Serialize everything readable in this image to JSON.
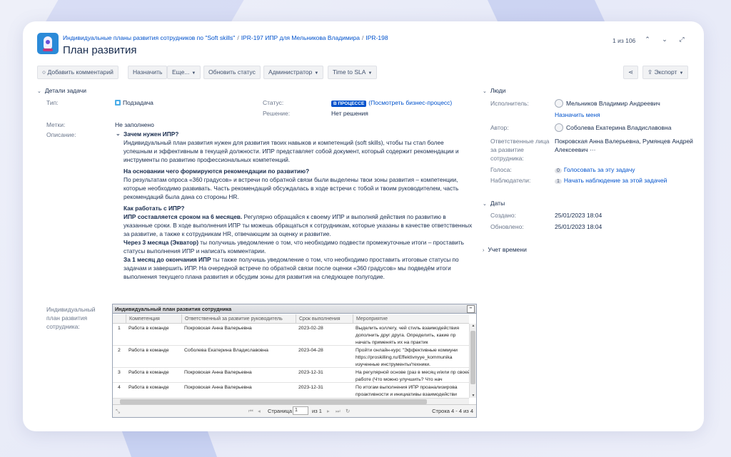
{
  "header": {
    "breadcrumb": [
      "Индивидуальные планы развития сотрудников по \"Soft skills\"",
      "IPR-197 ИПР для Мельникова Владимира",
      "IPR-198"
    ],
    "title": "План развития",
    "pager": "1 из 106"
  },
  "toolbar": {
    "add_comment": "Добавить комментарий",
    "assign": "Назначить",
    "more": "Еще...",
    "update_status": "Обновить статус",
    "admin": "Администратор",
    "time_to_sla": "Time to SLA",
    "export": "Экспорт"
  },
  "details": {
    "title": "Детали задачи",
    "type_label": "Тип:",
    "type_value": "Подзадача",
    "status_label": "Статус:",
    "status_lozenge": "В ПРОЦЕССЕ",
    "status_link": "(Посмотреть бизнес-процесс)",
    "resolution_label": "Решение:",
    "resolution_value": "Нет решения",
    "labels_label": "Метки:",
    "labels_value": "Не заполнено",
    "description_label": "Описание:",
    "ipr_label": [
      "Индивидуальный",
      "план развития",
      "сотрудника:"
    ]
  },
  "description": {
    "h1": "Зачем нужен ИПР?",
    "p1": "Индивидуальный план развития нужен для развития твоих навыков и компетенций (soft skills), чтобы ты стал более успешным и эффективным в текущей должности. ИПР представляет собой документ, который содержит рекомендации и инструменты по развитию профессиональных компетенций.",
    "h2": "На основании чего формируются рекомендации по развитию?",
    "p2": "По результатам опроса «360 градусов» и встречи по обратной связи были выделены твои зоны развития – компетенции, которые необходимо развивать. Часть рекомендаций обсуждалась в ходе встречи с тобой и твоим руководителем, часть рекомендаций была дана со стороны HR.",
    "h3": "Как работать с ИПР?",
    "p3_bold": "ИПР составляется сроком на 6 месяцев.",
    "p3": " Регулярно обращайся к своему ИПР и выполняй действия по развитию в указанные сроки. В ходе выполнения ИПР ты можешь обращаться к сотрудникам, которые указаны в качестве ответственных за развитие, а также к сотрудникам HR, отвечающим за оценку и развитие.",
    "p4_bold": "Через 3 месяца (Экватор)",
    "p4": " ты получишь уведомление о том, что необходимо подвести промежуточные итоги – проставить статусы выполнения ИПР и написать комментарии.",
    "p5_bold": "За 1 месяц до окончания ИПР",
    "p5": " ты также получишь уведомление о том, что необходимо проставить итоговые статусы по задачам и завершить ИПР. На очередной встрече по обратной связи после оценки «360 градусов» мы подведём итоги выполнения текущего плана развития и обсудим зоны для развития на следующее полугодие."
  },
  "grid": {
    "title": "Индивидуальный план развития сотрудника",
    "columns": [
      "Компетенция",
      "Ответственный за развитие руководитель",
      "Срок выполнения",
      "Мероприятие"
    ],
    "rows": [
      {
        "n": "1",
        "comp": "Работа в команде",
        "resp": "Покровская Анна Валерьевна",
        "date": "2023-02-28",
        "act": "Выделить коллегу, чей стиль взаимодействия дополнить друг друга. Определить, какие пр начать применять их на практик"
      },
      {
        "n": "2",
        "comp": "Работа в команде",
        "resp": "Соболева Екатерина Владиславовна",
        "date": "2023-04-28",
        "act": "Пройти онлайн-курс \"Эффективные коммуни https://proskilling.ru/Effektivnyye_kommunika изученные инструменты/техники."
      },
      {
        "n": "3",
        "comp": "Работа в команде",
        "resp": "Покровская Анна Валерьевна",
        "date": "2023-12-31",
        "act": "На регулярной основе (раз в месяц и/или пр своей работе (Что можно улучшить? Что нач"
      },
      {
        "n": "4",
        "comp": "Работа в команде",
        "resp": "Покровская Анна Валерьевна",
        "date": "2023-12-31",
        "act": "По итогам выполнения ИПР проанализирова проактивности и инициативы взаимодействи"
      }
    ],
    "page_label": "Страница",
    "page_value": "1",
    "of_pages": "из 1",
    "row_info": "Строка 4 - 4 из 4"
  },
  "people": {
    "title": "Люди",
    "assignee_label": "Исполнитель:",
    "assignee": "Мельников Владимир Андреевич",
    "assign_me": "Назначить меня",
    "author_label": "Автор:",
    "author": "Соболева Екатерина Владиславовна",
    "responsible_label": [
      "Ответственные лица",
      "за развитие",
      "сотрудника:"
    ],
    "responsible": [
      "Покровская Анна Валерьевна, Румянцев Андрей",
      "Алексеевич"
    ],
    "more": "···",
    "votes_label": "Голоса:",
    "votes_count": "0",
    "votes_link": "Голосовать за эту задачу",
    "watchers_label": "Наблюдатели:",
    "watchers_count": "1",
    "watchers_link": "Начать наблюдение за этой задачей"
  },
  "dates": {
    "title": "Даты",
    "created_label": "Создано:",
    "created": "25/01/2023 18:04",
    "updated_label": "Обновлено:",
    "updated": "25/01/2023 18:04"
  },
  "time_tracking": {
    "title": "Учет времени"
  }
}
